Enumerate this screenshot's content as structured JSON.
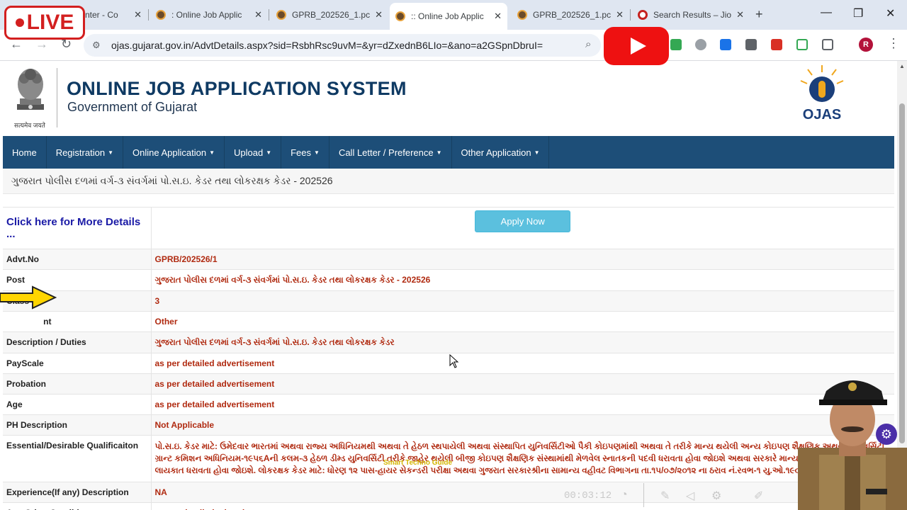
{
  "browser": {
    "tabs": [
      {
        "title": "nter - Co"
      },
      {
        "title": ": Online Job Applic"
      },
      {
        "title": "GPRB_202526_1.pc"
      },
      {
        "title": ":: Online Job Applic"
      },
      {
        "title": "GPRB_202526_1.pc"
      },
      {
        "title": "Search Results – Jio"
      }
    ],
    "new_tab_label": "+",
    "url": "ojas.gujarat.gov.in/AdvtDetails.aspx?sid=RsbhRsc9uvM=&yr=dZxednB6LIo=&ano=a2GSpnDbruI=",
    "profile_initial": "R"
  },
  "header": {
    "emblem_caption": "सत्यमेव जयते",
    "title": "ONLINE JOB APPLICATION SYSTEM",
    "subtitle": "Government of Gujarat",
    "logo_text": "OJAS"
  },
  "nav": {
    "items": [
      {
        "label": "Home",
        "dropdown": false
      },
      {
        "label": "Registration",
        "dropdown": true
      },
      {
        "label": "Online Application",
        "dropdown": true
      },
      {
        "label": "Upload",
        "dropdown": true
      },
      {
        "label": "Fees",
        "dropdown": true
      },
      {
        "label": "Call Letter / Preference",
        "dropdown": true
      },
      {
        "label": "Other Application",
        "dropdown": true
      }
    ]
  },
  "post_heading": "ગુજરાત પોલીસ દળમાં વર્ગ-૩ સંવર્ગમાં પો.સ.ઇ. કેડર તથા લોકરક્ષક કેડર - 202526",
  "details": {
    "more_link": "Click here for More Details ...",
    "apply_button": "Apply Now",
    "rows": [
      {
        "label": "Advt.No",
        "value": "GPRB/202526/1"
      },
      {
        "label": "Post",
        "value": "ગુજરાત પોલીસ દળમાં વર્ગ-૩ સંવર્ગમાં પો.સ.ઇ. કેડર તથા લોકરક્ષક કેડર - 202526"
      },
      {
        "label": "Class",
        "value": "3"
      },
      {
        "label": "nt",
        "value": "Other"
      },
      {
        "label": "Description / Duties",
        "value": "ગુજરાત પોલીસ દળમાં વર્ગ-૩ સંવર્ગમાં પો.સ.ઇ. કેડર તથા લોકરક્ષક કેડર"
      },
      {
        "label": "PayScale",
        "value": "as per detailed advertisement"
      },
      {
        "label": "Probation",
        "value": "as per detailed advertisement"
      },
      {
        "label": "Age",
        "value": "as per detailed advertisement"
      },
      {
        "label": "PH Description",
        "value": "Not Applicable"
      },
      {
        "label": "Essential/Desirable Qualificaiton",
        "value": "પો.સ.ઇ. કેડર માટે: ઉમેદવાર ભારતમાં અથવા રાજ્ય અધિનિયમથી અથવા તે હેઠળ સ્થપાયેલી અથવા સંસ્થાપિત યુનિવર્સિટીઓ પૈકી કોઇપણમાંથી અથવા તે તરીકે માન્ય થયેલી અન્ય કોઇપણ શૈક્ષણિક અથવા યુનિવર્સિટી ગ્રાન્ટ કમિશન અધિનિયમ-૧૯૫૬Aની કલમ-૩ હેઠળ ડીમ્ડ યુનિવર્સિટી તરીકે જાહેર થયેલી બીજી કોઇપણ શૈક્ષણિક સંસ્થામાંથી મેળવેલ સ્નાતકની પદવી ધરાવતા હોવા જોઇશે અથવા સરકારે માન્ય કરેલ તેની સમકક્ષ લાયકાત ધરાવતા હોવા જોઇશે. લોકરક્ષક કેડર માટે: ધોરણ ૧૨ પાસ-હાયર સેકન્ડરી પરીક્ષા અથવા ગુજરાત સરકારશ્રીના સામાન્ય વહીવટ વિભાગના તા.૧૫/૦૭/૨૦૧૨ ના ઠરાવ નં.રવભ-૧ યુ.ઓ.૧૯૦.ક માં જણાવ્યા મુજબ ધોરણ-૧૨ સમકક્ષ પરીક્ષા પાસ હોવા જોઇએ."
      },
      {
        "label": "Experience(If any) Description",
        "value": "NA"
      },
      {
        "label": "Any Other Conditions",
        "value": "as per detailed advertisement"
      }
    ]
  },
  "overlays": {
    "live_label": "LIVE",
    "watermark": "Smart Techno Guide",
    "timer": "00:03:12"
  },
  "colors": {
    "nav_bg": "#1d4e78",
    "title_color": "#0f3a63",
    "value_color": "#b02a10",
    "apply_button": "#5bc0de",
    "link_color": "#1a1aa6"
  }
}
